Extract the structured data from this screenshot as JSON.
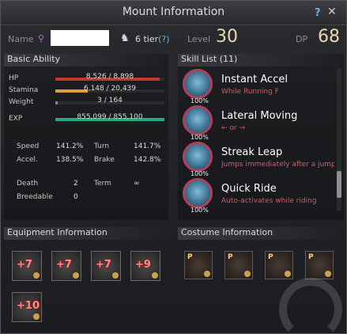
{
  "window": {
    "title": "Mount Information",
    "help": "?",
    "close": "✕"
  },
  "header": {
    "name_label": "Name",
    "tier_text": "6 tier",
    "tier_help": "(?)",
    "level_label": "Level",
    "level_value": "30",
    "dp_label": "DP",
    "dp_value": "68"
  },
  "basic": {
    "title": "Basic Ability",
    "bars": [
      {
        "label": "HP",
        "value": "8,526 / 8,898",
        "fraction": 0.958,
        "color": "#c0392b"
      },
      {
        "label": "Stamina",
        "value": "6,148 / 20,439",
        "fraction": 0.3,
        "color": "#e0a040"
      },
      {
        "label": "Weight",
        "value": "3 / 164",
        "fraction": 0.02,
        "color": "#888888"
      },
      {
        "label": "EXP",
        "value": "855,099 / 855,100",
        "fraction": 1.0,
        "color": "#2aa880"
      }
    ],
    "speed_label": "Speed",
    "speed": "141.2%",
    "turn_label": "Turn",
    "turn": "141.7%",
    "accel_label": "Accel.",
    "accel": "138.5%",
    "brake_label": "Brake",
    "brake": "142.8%",
    "death_label": "Death",
    "death": "2",
    "term_label": "Term",
    "term": "∞",
    "breedable_label": "Breedable",
    "breedable": "0"
  },
  "skills": {
    "title": "Skill List (11)",
    "items": [
      {
        "name": "Instant Accel",
        "desc": "While Running F",
        "pct": "100%",
        "icon": "sprint-icon"
      },
      {
        "name": "Lateral Moving",
        "desc": "← or →",
        "pct": "100%",
        "icon": "lateral-icon"
      },
      {
        "name": "Streak Leap",
        "desc": "Jumps immediately after a jump",
        "pct": "100%",
        "icon": "leap-icon"
      },
      {
        "name": "Quick Ride",
        "desc": "Auto-activates while riding",
        "pct": "100%",
        "icon": "ride-icon"
      }
    ]
  },
  "equipment": {
    "title": "Equipment Information",
    "items": [
      {
        "enh": "+7",
        "icon": "stirrups-icon"
      },
      {
        "enh": "+7",
        "icon": "barding-icon"
      },
      {
        "enh": "+7",
        "icon": "saddle-icon"
      },
      {
        "enh": "+9",
        "icon": "champron-icon"
      },
      {
        "enh": "+10",
        "icon": "horseshoe-icon"
      }
    ]
  },
  "costume": {
    "title": "Costume Information",
    "items": [
      {
        "badge": "P",
        "icon": "costume-barding-icon"
      },
      {
        "badge": "P",
        "icon": "costume-saddle-icon"
      },
      {
        "badge": "P",
        "icon": "costume-stirrups-icon"
      },
      {
        "badge": "P",
        "icon": "costume-champron-icon"
      }
    ]
  }
}
